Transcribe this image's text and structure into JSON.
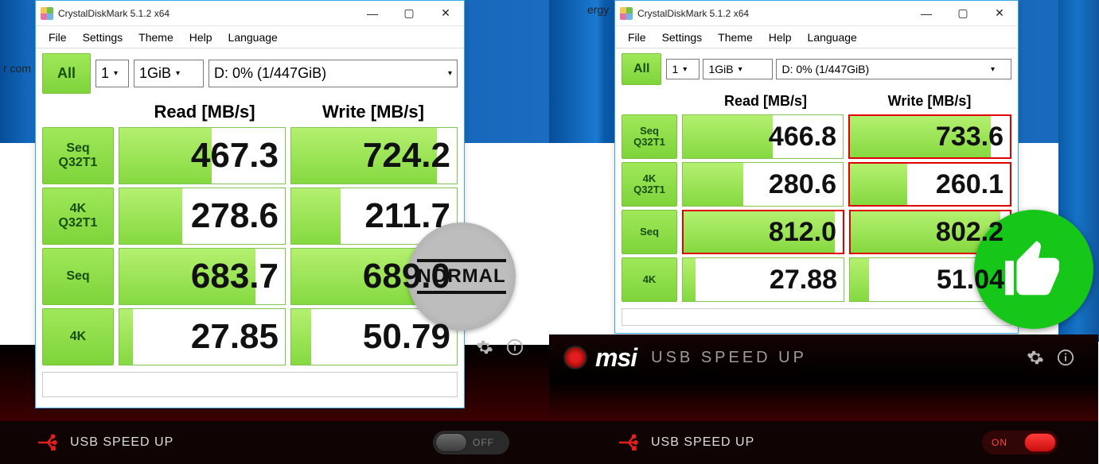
{
  "app_title": "CrystalDiskMark 5.1.2 x64",
  "menus": [
    "File",
    "Settings",
    "Theme",
    "Help",
    "Language"
  ],
  "all_label": "All",
  "run_count": "1",
  "test_size": "1GiB",
  "drive": "D: 0% (1/447GiB)",
  "header_read": "Read [MB/s]",
  "header_write": "Write [MB/s]",
  "row_labels": {
    "seq_q32t1": "Seq\nQ32T1",
    "4k_q32t1": "4K\nQ32T1",
    "seq": "Seq",
    "4k": "4K"
  },
  "chart_data": {
    "type": "table",
    "units": "MB/s",
    "columns": [
      "Read",
      "Write"
    ],
    "left": {
      "label": "Normal",
      "rows": {
        "Seq Q32T1": [
          467.3,
          724.2
        ],
        "4K Q32T1": [
          278.6,
          211.7
        ],
        "Seq": [
          683.7,
          689.0
        ],
        "4K": [
          27.85,
          50.79
        ]
      }
    },
    "right": {
      "label": "USB Speed Up On",
      "rows": {
        "Seq Q32T1": [
          466.8,
          733.6
        ],
        "4K Q32T1": [
          280.6,
          260.1
        ],
        "Seq": [
          812.0,
          802.2
        ],
        "4K": [
          27.88,
          51.04
        ]
      },
      "highlighted": [
        "Seq Q32T1 Write",
        "4K Q32T1 Write",
        "Seq Read",
        "Seq Write"
      ]
    }
  },
  "left": {
    "seq_q32t1": {
      "read": "467.3",
      "write": "724.2",
      "rfill": 56,
      "wfill": 88
    },
    "k4_q32t1": {
      "read": "278.6",
      "write": "211.7",
      "rfill": 38,
      "wfill": 30
    },
    "seq": {
      "read": "683.7",
      "write": "689.0",
      "rfill": 82,
      "wfill": 82
    },
    "k4": {
      "read": "27.85",
      "write": "50.79",
      "rfill": 8,
      "wfill": 12
    }
  },
  "right": {
    "seq_q32t1": {
      "read": "466.8",
      "write": "733.6",
      "rfill": 56,
      "wfill": 88
    },
    "k4_q32t1": {
      "read": "280.6",
      "write": "260.1",
      "rfill": 38,
      "wfill": 36
    },
    "seq": {
      "read": "812.0",
      "write": "802.2",
      "rfill": 95,
      "wfill": 94
    },
    "k4": {
      "read": "27.88",
      "write": "51.04",
      "rfill": 8,
      "wfill": 12
    }
  },
  "normal_badge": "NORMAL",
  "msi_brand": "msi",
  "msi_sub": "USB SPEED UP",
  "usb_label": "USB SPEED UP",
  "toggle_off": "OFF",
  "toggle_on": "ON",
  "partial_left": "r com",
  "partial_right": "ergy"
}
